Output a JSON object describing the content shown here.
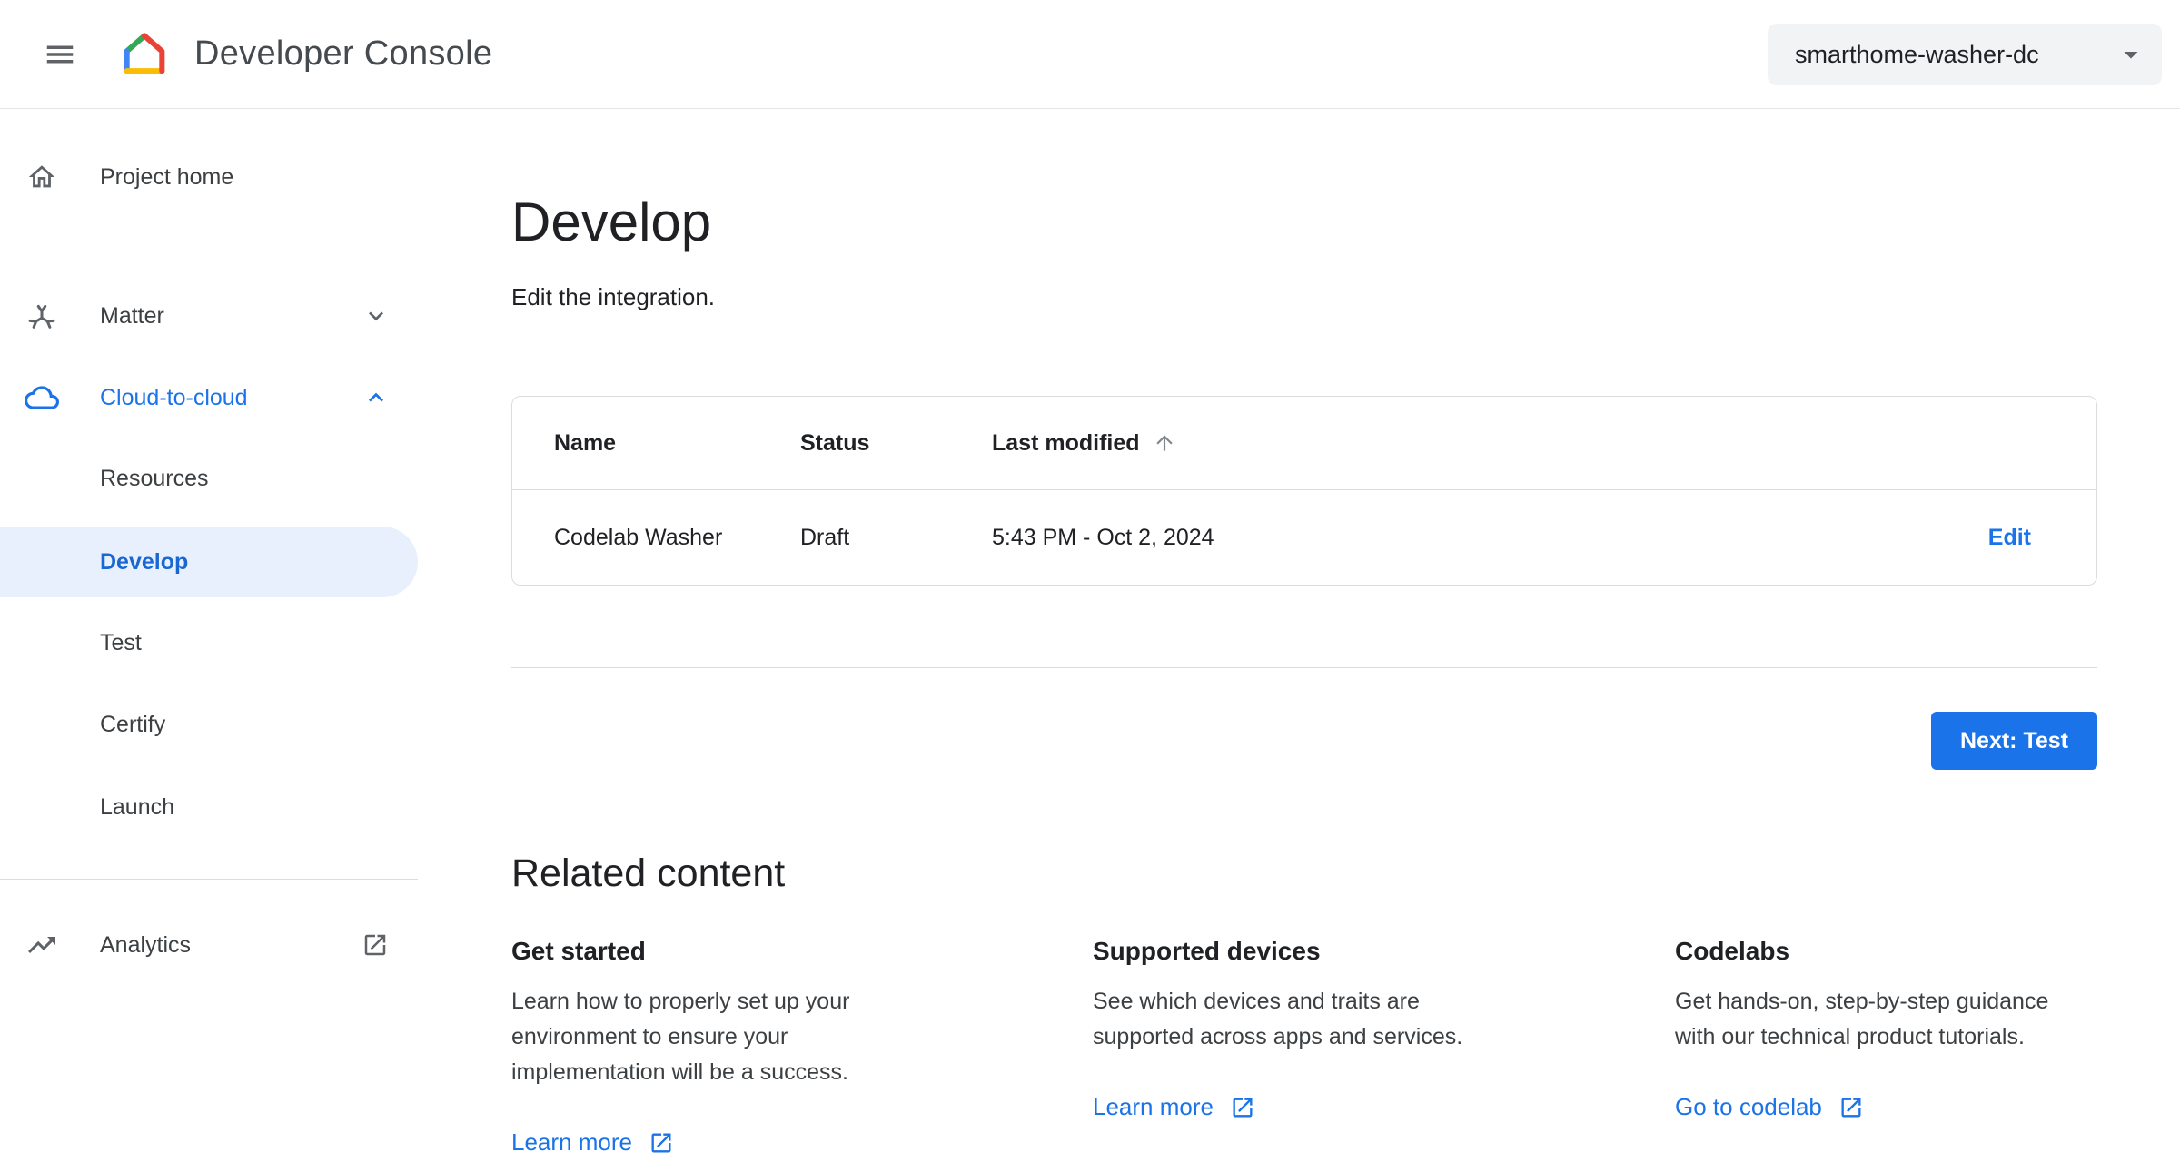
{
  "header": {
    "title": "Developer Console",
    "project": "smarthome-washer-dc"
  },
  "sidebar": {
    "project_home": "Project home",
    "matter": "Matter",
    "cloud_to_cloud": "Cloud-to-cloud",
    "cloud_items": [
      "Resources",
      "Develop",
      "Test",
      "Certify",
      "Launch"
    ],
    "analytics": "Analytics"
  },
  "main": {
    "title": "Develop",
    "subtitle": "Edit the integration.",
    "table": {
      "columns": [
        "Name",
        "Status",
        "Last modified"
      ],
      "rows": [
        {
          "name": "Codelab Washer",
          "status": "Draft",
          "last_modified": "5:43 PM - Oct 2, 2024",
          "action": "Edit"
        }
      ]
    },
    "next_button": "Next: Test",
    "related": {
      "title": "Related content",
      "cards": [
        {
          "title": "Get started",
          "body": "Learn how to properly set up your environment to ensure your implementation will be a success.",
          "link": "Learn more"
        },
        {
          "title": "Supported devices",
          "body": "See which devices and traits are supported across apps and services.",
          "link": "Learn more"
        },
        {
          "title": "Codelabs",
          "body": "Get hands-on, step-by-step guidance with our technical product tutorials.",
          "link": "Go to codelab"
        }
      ]
    }
  },
  "icons": {
    "menu": "hamburger",
    "logo": "google-home-house",
    "project_caret": "caret-down",
    "matter": "matter-tri-arm",
    "cloud": "cloud-outline",
    "analytics": "trending-up",
    "external": "open-in-new",
    "sort": "arrow-upward"
  },
  "colors": {
    "accent": "#1a73e8",
    "selected_bg": "#e8f0fe",
    "selected_text": "#1967d2",
    "pill_bg": "#f1f3f4",
    "border": "#dadce0"
  }
}
